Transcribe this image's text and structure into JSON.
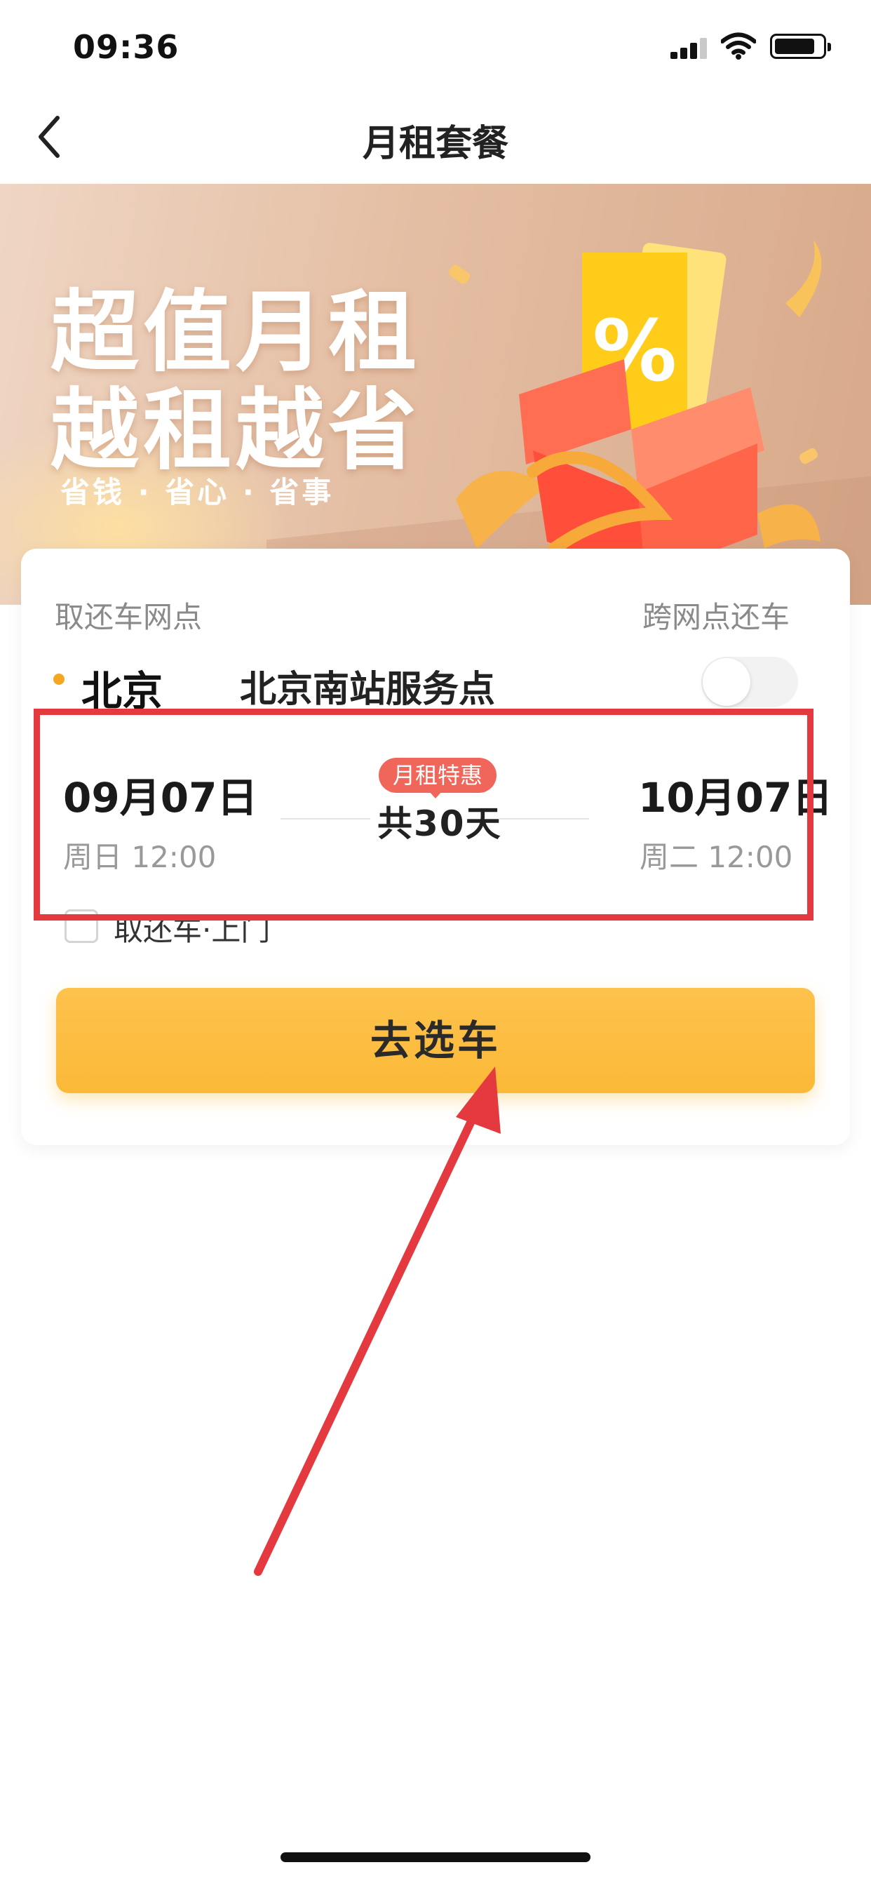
{
  "status_bar": {
    "time": "09:36"
  },
  "nav": {
    "title": "月租套餐"
  },
  "banner": {
    "line1": "超值月租",
    "line2": "越租越省",
    "sub": "省钱 · 省心 · 省事",
    "gift_symbol": "%"
  },
  "card": {
    "pickup_label": "取还车网点",
    "cross_label": "跨网点还车",
    "city": "北京",
    "station": "北京南站服务点",
    "cross_enabled": false,
    "start_date": "09月07日",
    "start_time": "周日 12:00",
    "end_date": "10月07日",
    "end_time": "周二 12:00",
    "promo_badge": "月租特惠",
    "duration": "共30天",
    "door_label": "取还车·上门",
    "cta": "去选车"
  },
  "colors": {
    "accent_yellow": "#fbb937",
    "promo_red": "#f0665a",
    "annotation_red": "#e43a3f",
    "dot_orange": "#f5a623"
  },
  "icons": {
    "back": "chevron-left-icon",
    "signal": "cellular-signal-icon",
    "wifi": "wifi-icon",
    "battery": "battery-icon"
  }
}
